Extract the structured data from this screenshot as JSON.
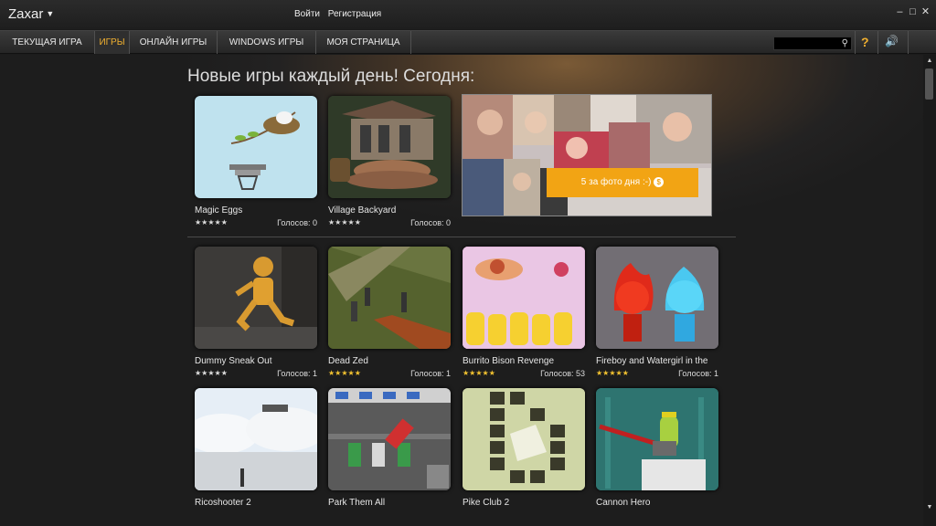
{
  "titlebar": {
    "brand": "Zaxar",
    "login": "Войти",
    "register": "Регистрация"
  },
  "nav": {
    "tabs": [
      {
        "label": "ТЕКУЩАЯ ИГРА",
        "active": false
      },
      {
        "label": "ИГРЫ",
        "active": true
      },
      {
        "label": "ОНЛАЙН ИГРЫ",
        "active": false
      },
      {
        "label": "WINDOWS ИГРЫ",
        "active": false
      },
      {
        "label": "МОЯ СТРАНИЦА",
        "active": false
      }
    ],
    "search_value": "",
    "help_label": "?"
  },
  "main": {
    "headline": "Новые игры каждый день! Сегодня:",
    "promo": {
      "text": "5 за фото дня :-)",
      "coin": "$"
    },
    "games": [
      {
        "name": "Magic Eggs",
        "votes": "Голосов: 0",
        "rating_stars": 5,
        "rated": false
      },
      {
        "name": "Village Backyard",
        "votes": "Голосов: 0",
        "rating_stars": 5,
        "rated": false
      },
      {
        "name": "Dummy Sneak Out",
        "votes": "Голосов: 1",
        "rating_stars": 5,
        "rated": false
      },
      {
        "name": "Dead Zed",
        "votes": "Голосов: 1",
        "rating_stars": 5,
        "rated": true
      },
      {
        "name": "Burrito Bison Revenge",
        "votes": "Голосов: 53",
        "rating_stars": 5,
        "rated": true
      },
      {
        "name": "Fireboy and Watergirl in the",
        "votes": "Голосов: 1",
        "rating_stars": 5,
        "rated": true
      },
      {
        "name": "Ricoshooter 2"
      },
      {
        "name": "Park Them All"
      },
      {
        "name": "Pike Club 2"
      },
      {
        "name": "Cannon Hero"
      }
    ]
  },
  "colors": {
    "accent": "#f0b030",
    "promo_button": "#f2a414"
  }
}
